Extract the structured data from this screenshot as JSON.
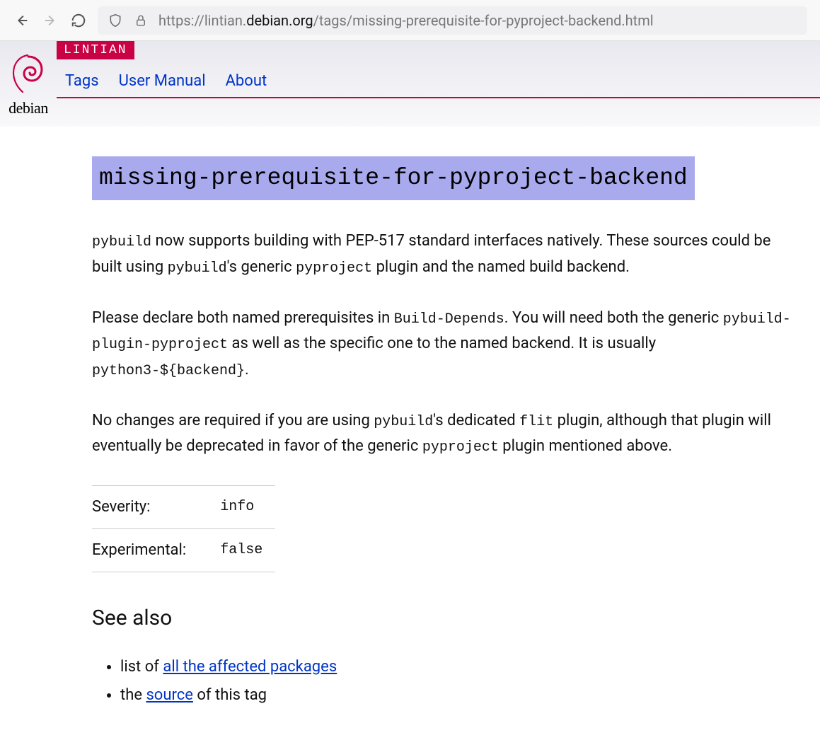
{
  "browser": {
    "url_prefix": "https://lintian.",
    "url_domain": "debian.org",
    "url_suffix": "/tags/missing-prerequisite-for-pyproject-backend.html"
  },
  "header": {
    "badge": "LINTIAN",
    "logo_text": "debian",
    "tabs": [
      "Tags",
      "User Manual",
      "About"
    ]
  },
  "page": {
    "tag_name": "missing-prerequisite-for-pyproject-backend",
    "p1_a": " now supports building with PEP-517 standard interfaces natively. These sources could be built using ",
    "p1_b": "'s generic ",
    "p1_c": " plugin and the named build backend.",
    "code_pybuild": "pybuild",
    "code_pyproject": "pyproject",
    "p2_a": "Please declare both named prerequisites in ",
    "code_builddepends": "Build-Depends",
    "p2_b": ". You will need both the generic ",
    "code_ppp": "pybuild-plugin-pyproject",
    "p2_c": " as well as the specific one to the named backend. It is usually ",
    "code_py3backend": "python3-${backend}",
    "p2_d": ".",
    "p3_a": "No changes are required if you are using ",
    "p3_b": "'s dedicated ",
    "code_flit": "flit",
    "p3_c": " plugin, although that plugin will eventually be deprecated in favor of the generic ",
    "p3_d": " plugin mentioned above.",
    "meta": {
      "severity_label": "Severity:",
      "severity_value": "info",
      "experimental_label": "Experimental:",
      "experimental_value": "false"
    },
    "see_also_heading": "See also",
    "see1_pre": "list of ",
    "see1_link": "all the affected packages",
    "see2_pre": "the ",
    "see2_link": "source",
    "see2_post": " of this tag"
  }
}
